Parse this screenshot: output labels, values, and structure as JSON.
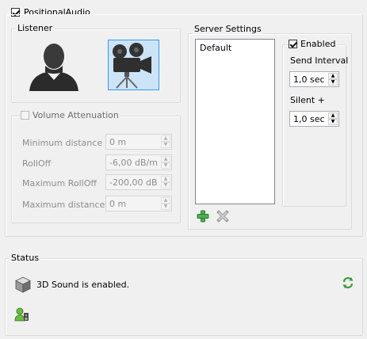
{
  "positional_audio": {
    "label": "PositionalAudio",
    "checked": true
  },
  "listener": {
    "title": "Listener",
    "head_icon": "head-silhouette-icon",
    "camera_icon": "movie-camera-icon"
  },
  "volume_attenuation": {
    "label": "Volume Attenuation",
    "checked": false,
    "fields": [
      {
        "label": "Minimum distance",
        "value": "0 m"
      },
      {
        "label": "RollOff",
        "value": "-6,00 dB/m"
      },
      {
        "label": "Maximum RollOff",
        "value": "-200,00 dB"
      },
      {
        "label": "Maximum distance",
        "value": "0 m"
      }
    ]
  },
  "server_settings": {
    "title": "Server Settings",
    "list_items": [
      "Default"
    ],
    "add_icon": "add-icon",
    "remove_icon": "remove-icon",
    "enabled": {
      "label": "Enabled",
      "checked": true
    },
    "send_interval": {
      "label": "Send Interval",
      "value": "1,0 sec"
    },
    "silent": {
      "label": "Silent +",
      "value": "1,0 sec"
    }
  },
  "status": {
    "title": "Status",
    "message": "3D Sound is enabled.",
    "cube_icon": "cube-icon",
    "refresh_icon": "refresh-icon",
    "users_icon": "users-speaker-icon"
  }
}
